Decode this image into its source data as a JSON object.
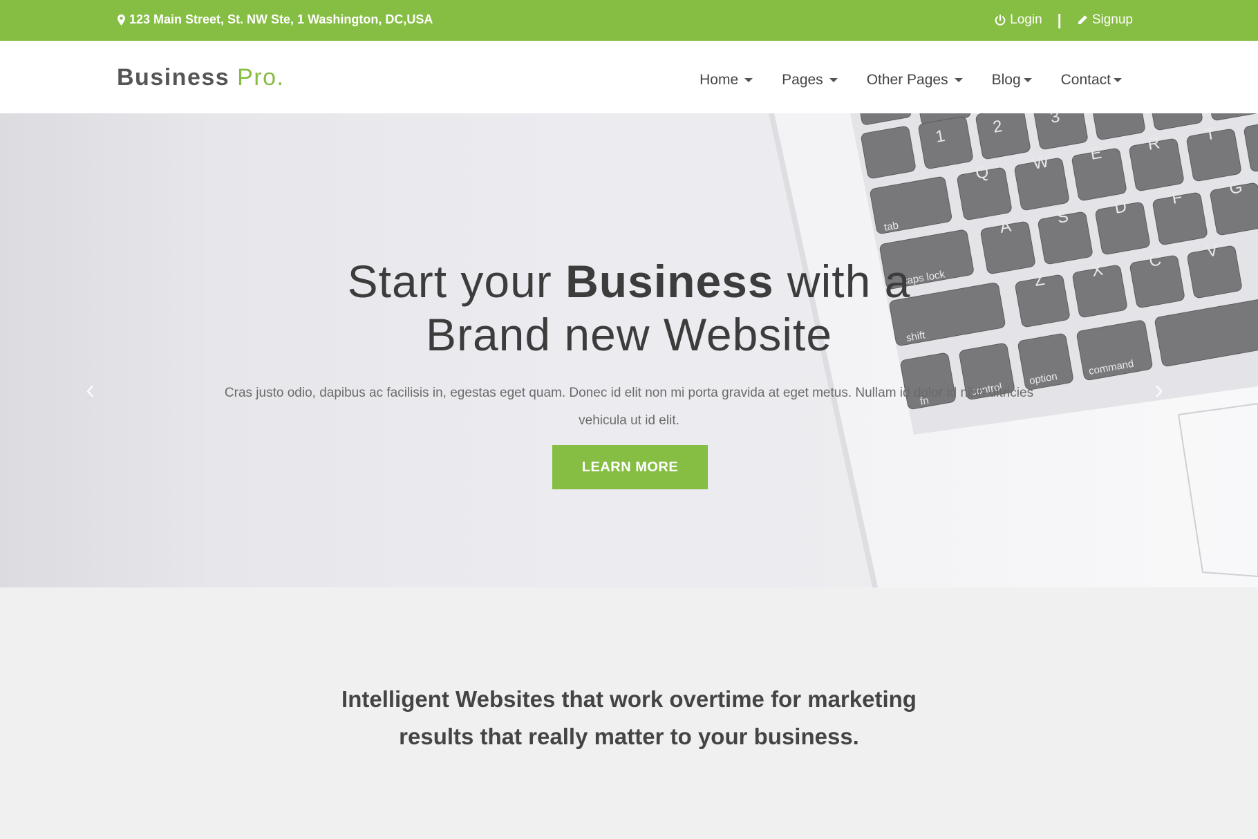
{
  "topbar": {
    "address": "123 Main Street, St. NW Ste, 1 Washington, DC,USA",
    "address_icon": "map-marker-icon",
    "login_label": "Login",
    "login_icon": "power-icon",
    "separator": "|",
    "signup_label": "Signup",
    "signup_icon": "pencil-icon"
  },
  "navbar": {
    "brand_main": "Business",
    "brand_accent": "Pro.",
    "items": [
      {
        "label": "Home"
      },
      {
        "label": "Pages"
      },
      {
        "label": "Other Pages"
      },
      {
        "label": "Blog"
      },
      {
        "label": "Contact"
      }
    ]
  },
  "hero": {
    "heading_part1": "Start your ",
    "heading_bold": "Business",
    "heading_part2": " with a",
    "heading_line2": "Brand new Website",
    "text": "Cras justo odio, dapibus ac facilisis in, egestas eget quam. Donec id elit non mi porta gravida at eget metus. Nullam id dolor id nibh ultricies vehicula ut id elit.",
    "button_label": "LEARN MORE",
    "prev_icon": "chevron-left-icon",
    "next_icon": "chevron-right-icon",
    "image": "laptop-keyboard-photo"
  },
  "section": {
    "heading_line1": "Intelligent Websites that work overtime for marketing",
    "heading_line2": "results that really matter to your business."
  },
  "colors": {
    "accent": "#86bd43",
    "text_dark": "#3c3c3c",
    "section_bg": "#f0f0f0"
  }
}
